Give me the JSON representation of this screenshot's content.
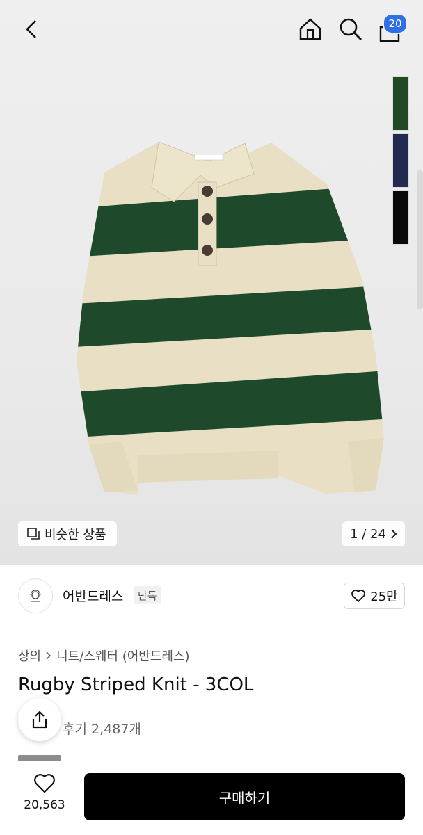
{
  "header": {
    "cart_count": "20",
    "icons": [
      "back-icon",
      "home-icon",
      "search-icon",
      "cart-icon"
    ]
  },
  "gallery": {
    "similar_label": "비슷한 상품",
    "page_indicator": "1 / 24",
    "swatch_colors": [
      "#1f4a25",
      "#222a52",
      "#0a0a0a"
    ]
  },
  "brand": {
    "name": "어반드레스",
    "exclusive_tag": "단독",
    "like_count": "25만"
  },
  "product": {
    "breadcrumb": [
      "상의",
      "니트/스웨터 (어반드레스)"
    ],
    "title": "Rugby Striped Knit - 3COL",
    "review_text": "후기 2,487개"
  },
  "bottom": {
    "favorite_count": "20,563",
    "buy_label": "구매하기"
  },
  "colors": {
    "accent": "#2f6fe8",
    "buy_button": "#000000"
  }
}
